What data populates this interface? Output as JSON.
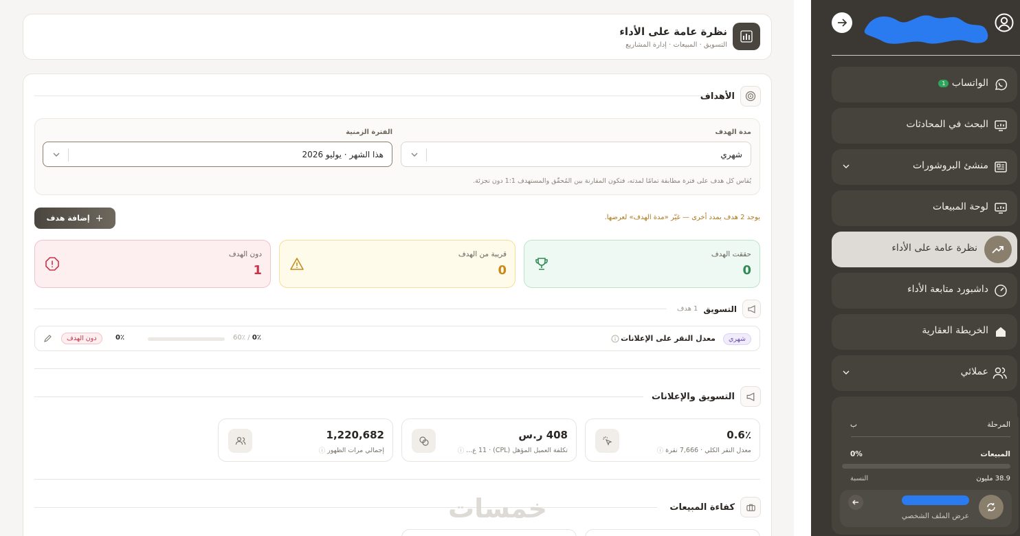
{
  "header": {
    "title": "نظرة عامة على الأداء",
    "breadcrumb": "التسويق · المبيعات · إدارة المشاريع"
  },
  "goals": {
    "title": "الأهداف",
    "duration_label": "مدة الهدف",
    "duration_value": "شهري",
    "period_label": "الفترة الزمنية",
    "period_value": "هذا الشهر · يوليو 2026",
    "note": "يُقاس كل هدف على فترة مطابقة تمامًا لمدته، فتكون المقارنة بين المُحقّق والمستهدف 1:1 دون تجزئة.",
    "hidden_warning": "يوجد 2 هدف بمدد أخرى — غيّر «مدة الهدف» لعرضها.",
    "add_button": "إضافة هدف",
    "stats": [
      {
        "label": "حققت الهدف",
        "value": "0",
        "color": "#2f8a55"
      },
      {
        "label": "قريبة من الهدف",
        "value": "0",
        "color": "#c98a1a"
      },
      {
        "label": "دون الهدف",
        "value": "1",
        "color": "#c8334a"
      }
    ],
    "group": {
      "name": "التسويق",
      "count": "1 هدف",
      "row": {
        "period": "شهري",
        "name": "معدل النقر على الإعلانات",
        "actual": "0٪",
        "target": "60٪",
        "separator": "/",
        "percent": "0٪",
        "progress": 0,
        "status": "دون الهدف"
      }
    }
  },
  "marketing": {
    "title": "التسويق والإعلانات",
    "kpis": [
      {
        "value": "0.6٪",
        "sub": "معدل النقر الكلي · 7,666 نقرة",
        "icon": "cursor-click-icon"
      },
      {
        "value": "408 ر.س",
        "sub": "تكلفة العميل المؤهل (CPL) · 11 ع...",
        "icon": "coins-icon"
      },
      {
        "value": "1,220,682",
        "sub": "إجمالي مرات الظهور",
        "icon": "users-icon"
      }
    ]
  },
  "sales_efficiency": {
    "title": "كفاءة المبيعات"
  },
  "watermark": "خمسات",
  "sidebar": {
    "items": [
      {
        "label": "الواتساب",
        "badge": "1",
        "icon": "whatsapp-icon"
      },
      {
        "label": "البحث في المحادثات",
        "icon": "chat-search-icon"
      },
      {
        "label": "منشئ البروشورات",
        "icon": "brochure-icon"
      },
      {
        "label": "لوحة المبيعات",
        "icon": "sales-board-icon"
      },
      {
        "label": "نظرة عامة على الأداء",
        "icon": "trend-up-icon",
        "active": true
      },
      {
        "label": "داشبورد متابعة الأداء",
        "icon": "gauge-icon"
      },
      {
        "label": "الخريطة العقارية",
        "icon": "home-icon"
      },
      {
        "label": "عملائي",
        "icon": "users-icon"
      }
    ],
    "stage_card": {
      "stage_label": "المرحلة",
      "stage_value": "ب",
      "sales_label": "المبيعات",
      "sales_percent": "0%",
      "progress": 0,
      "amount": "38.9 مليون",
      "ratio_label": "النسبة",
      "profile_label": "عرض الملف الشخصي"
    },
    "colors": {
      "bg": "#3b3833",
      "item": "#46423c",
      "active": "#dedbd6"
    }
  }
}
